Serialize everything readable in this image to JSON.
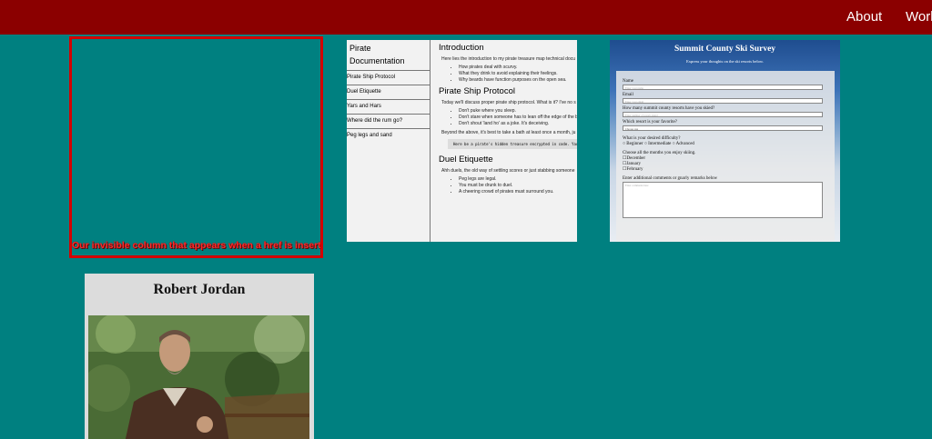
{
  "nav": {
    "about": "About",
    "work": "Work"
  },
  "invisible_column": {
    "caption": "Our invisible column that appears when a href is inserted"
  },
  "pirate_docs": {
    "title": "Pirate Documentation",
    "nav_items": [
      "Pirate Ship Protocol",
      "Duel Etiquette",
      "Yars and Hars",
      "Where did the rum go?",
      "Peg legs and sand"
    ],
    "intro_heading": "Introduction",
    "intro_text": "Here lies the introduction to my pirate treasure map technical docu",
    "intro_list": [
      "How pirates deal with scurvy.",
      "What they drink to avoid explaining their feelings.",
      "Why beards have function purposes on the open sea."
    ],
    "protocol_heading": "Pirate Ship Protocol",
    "protocol_text": "Today we'll discuss proper pirate ship protocol. What is it? I've no s",
    "protocol_list": [
      "Don't puke where you sleep.",
      "Don't stare when someone has to lean off the edge of the b",
      "Don't shout 'land ho' as a joke. It's deceiving."
    ],
    "protocol_text2": "Beyond the above, it's best to take a bath at least once a month, ju",
    "code": "Here be a pirate's hidden treasure encrypted in code. Yar!",
    "duel_heading": "Duel Etiquette",
    "duel_text": "Ahh duels, the old way of settling scores or just stabbing someone",
    "duel_list": [
      "Peg legs are legal.",
      "You must be drunk to duel.",
      "A cheering crowd of pirates must surround you."
    ]
  },
  "ski_survey": {
    "title": "Summit County Ski Survey",
    "subtitle": "Express your thoughts on the ski resorts below.",
    "name_label": "Name",
    "name_placeholder": "Enter your name",
    "email_label": "Email",
    "email_placeholder": "Enter your email",
    "resorts_label": "How many summit county resorts have you skied?",
    "resorts_placeholder": "Enter number of resorts skied",
    "favorite_label": "Which resort is your favorite?",
    "favorite_value": "Choose one",
    "difficulty_label": "What is your desired difficulty?",
    "difficulty_options": [
      "Beginner",
      "Intermediate",
      "Advanced"
    ],
    "months_label": "Choose all the months you enjoy skiing.",
    "months": [
      "December",
      "January",
      "February"
    ],
    "comments_label": "Enter additional comments or gnarly remarks below",
    "comments_placeholder": "Enter comments here"
  },
  "author_card": {
    "name": "Robert Jordan"
  }
}
